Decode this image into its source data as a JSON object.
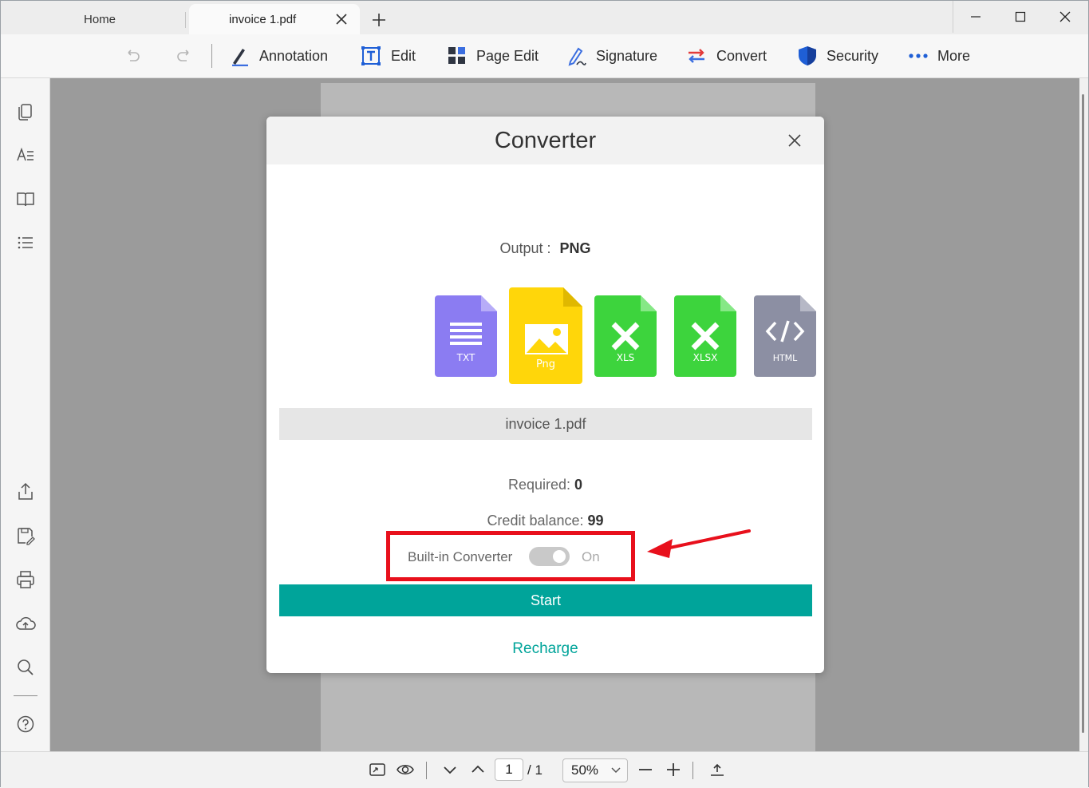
{
  "tabs": [
    {
      "label": "Home"
    },
    {
      "label": "invoice 1.pdf"
    }
  ],
  "toolbar": {
    "items": [
      {
        "label": "Annotation",
        "icon": "pen-icon"
      },
      {
        "label": "Edit",
        "icon": "text-box-icon"
      },
      {
        "label": "Page Edit",
        "icon": "grid-icon"
      },
      {
        "label": "Signature",
        "icon": "signature-pen-icon"
      },
      {
        "label": "Convert",
        "icon": "convert-arrows-icon"
      },
      {
        "label": "Security",
        "icon": "shield-icon"
      },
      {
        "label": "More",
        "icon": "dots-icon"
      }
    ]
  },
  "dialog": {
    "title": "Converter",
    "output_label": "Output :",
    "output_value": "PNG",
    "formats": [
      {
        "label": "TXT",
        "color": "#8b7cf2"
      },
      {
        "label": "Png",
        "color": "#ffd60a",
        "selected": true
      },
      {
        "label": "XLS",
        "color": "#3dd43d"
      },
      {
        "label": "XLSX",
        "color": "#3dd43d"
      },
      {
        "label": "HTML",
        "color": "#8c8fa3"
      }
    ],
    "filename": "invoice 1.pdf",
    "required_label": "Required:",
    "required_value": "0",
    "credit_label": "Credit balance:",
    "credit_value": "99",
    "builtin_label": "Built-in Converter",
    "builtin_state": "On",
    "start_label": "Start",
    "recharge_label": "Recharge"
  },
  "status": {
    "page_current": "1",
    "page_total": "/ 1",
    "zoom": "50%"
  },
  "colors": {
    "accent": "#00a49a",
    "highlight": "#e8101c"
  }
}
